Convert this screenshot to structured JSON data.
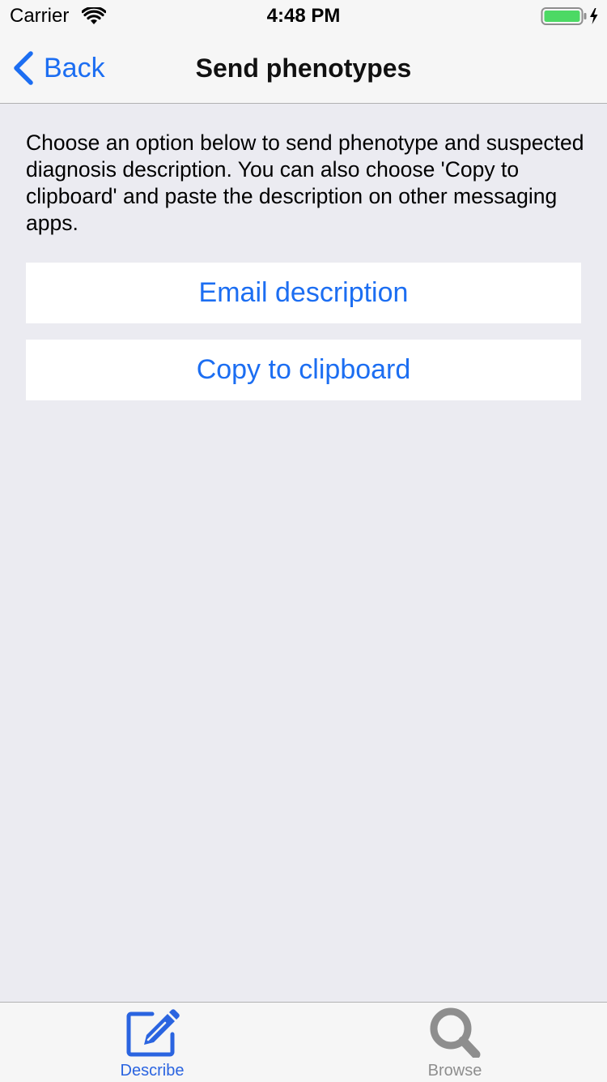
{
  "status_bar": {
    "carrier": "Carrier",
    "time": "4:48 PM",
    "wifi_icon": "wifi-icon",
    "battery_icon": "battery-charging-icon",
    "battery_color": "#4cd964"
  },
  "nav_bar": {
    "back_label": "Back",
    "back_icon": "chevron-left-icon",
    "title": "Send phenotypes"
  },
  "main": {
    "description": "Choose an option below to send phenotype and suspected diagnosis description. You can also choose 'Copy to clipboard' and paste the description on other messaging apps.",
    "buttons": [
      {
        "label": "Email description"
      },
      {
        "label": "Copy to clipboard"
      }
    ]
  },
  "tab_bar": {
    "tabs": [
      {
        "label": "Describe",
        "icon": "edit-pencil-icon",
        "selected": true
      },
      {
        "label": "Browse",
        "icon": "search-icon",
        "selected": false
      }
    ]
  },
  "colors": {
    "accent": "#1c6ef2",
    "background": "#ebebf1",
    "bar_background": "#f6f6f6",
    "tab_inactive": "#8e8e8e"
  }
}
